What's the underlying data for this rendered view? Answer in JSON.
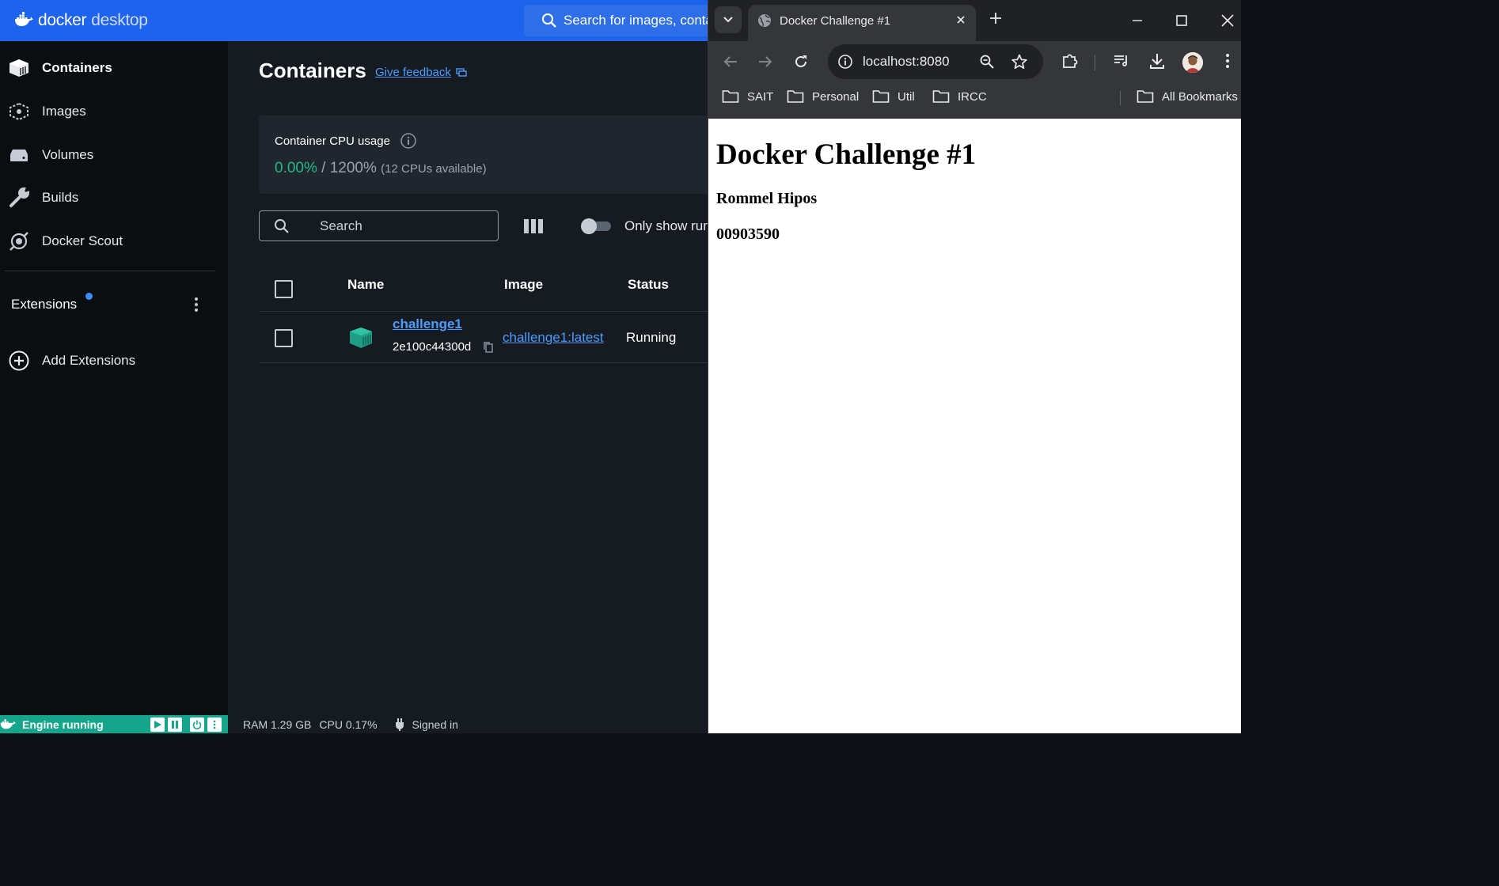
{
  "docker": {
    "brand_main": "docker",
    "brand_sub": "desktop",
    "search_placeholder": "Search for images, containers, volumes, extensions and more...",
    "sidebar": {
      "items": [
        {
          "label": "Containers",
          "icon": "containers-icon"
        },
        {
          "label": "Images",
          "icon": "images-icon"
        },
        {
          "label": "Volumes",
          "icon": "volumes-icon"
        },
        {
          "label": "Builds",
          "icon": "wrench-icon"
        },
        {
          "label": "Docker Scout",
          "icon": "scout-icon"
        }
      ],
      "extensions_label": "Extensions",
      "add_extensions_label": "Add Extensions"
    },
    "main": {
      "title": "Containers",
      "feedback_label": "Give feedback",
      "cpu": {
        "title": "Container CPU usage",
        "value": "0.00%",
        "separator": "/",
        "max": "1200%",
        "available": "(12 CPUs available)"
      },
      "search_placeholder": "Search",
      "only_show_running": "Only show running containers",
      "table": {
        "columns": [
          "Name",
          "Image",
          "Status"
        ],
        "rows": [
          {
            "name": "challenge1",
            "id": "2e100c44300d",
            "image": "challenge1:latest",
            "status": "Running"
          }
        ]
      }
    },
    "status_bar": {
      "engine": "Engine running",
      "ram": "RAM 1.29 GB",
      "cpu": "CPU 0.17%",
      "signed_in": "Signed in"
    },
    "colors": {
      "accent": "#1d63ed",
      "engine": "#14a58a",
      "running": "#22b98a",
      "link": "#4d9bff"
    }
  },
  "browser": {
    "tab_title": "Docker Challenge #1",
    "url": "localhost:8080",
    "bookmarks": [
      "SAIT",
      "Personal",
      "Util",
      "IRCC"
    ],
    "all_bookmarks": "All Bookmarks",
    "page": {
      "heading": "Docker Challenge #1",
      "name": "Rommel Hipos",
      "student_id": "00903590"
    }
  }
}
